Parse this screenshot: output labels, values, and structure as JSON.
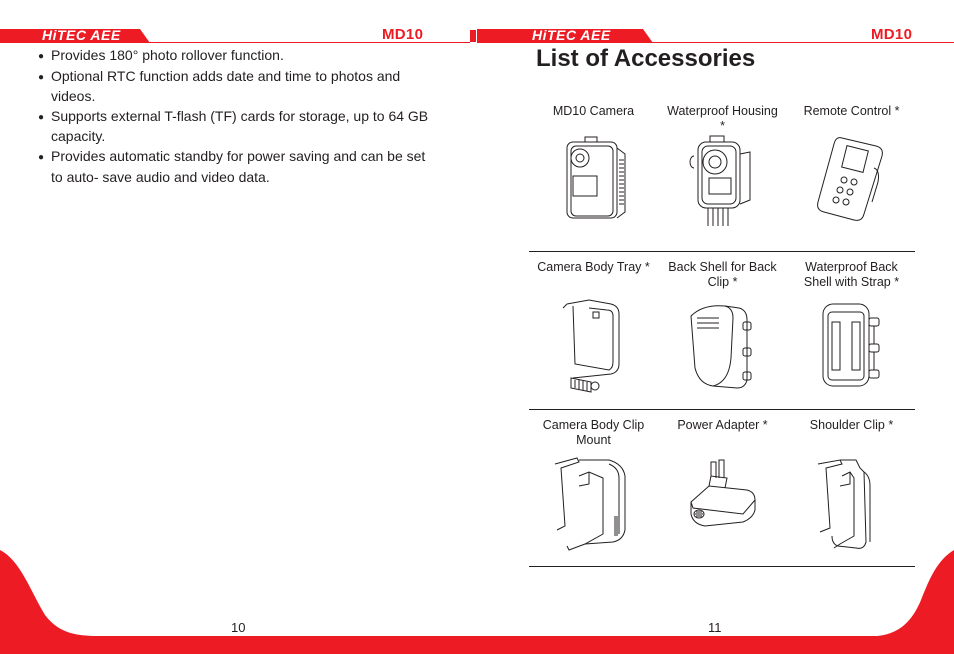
{
  "brand": {
    "logo_text": "HiTEC AEE",
    "model": "MD10",
    "accent_color": "#ed1c24"
  },
  "left_page": {
    "page_number": "10",
    "bullets": [
      "Provides 180° photo rollover function.",
      "Optional RTC function adds date and time to photos and videos.",
      "Supports external T-flash (TF) cards for storage, up to 64 GB capacity.",
      "Provides automatic standby for power saving and can be set to auto- save audio and video data."
    ]
  },
  "right_page": {
    "page_number": "11",
    "title": "List of Accessories",
    "accessories": [
      {
        "label": "MD10 Camera",
        "icon": "camera-icon"
      },
      {
        "label": "Waterproof Housing *",
        "icon": "waterproof-housing-icon"
      },
      {
        "label": "Remote Control *",
        "icon": "remote-control-icon"
      },
      {
        "label": "Camera Body Tray *",
        "icon": "body-tray-icon"
      },
      {
        "label": "Back Shell for Back Clip *",
        "icon": "back-shell-clip-icon"
      },
      {
        "label": "Waterproof Back Shell with Strap *",
        "icon": "back-shell-strap-icon"
      },
      {
        "label": "Camera Body Clip Mount",
        "icon": "clip-mount-icon"
      },
      {
        "label": "Power Adapter *",
        "icon": "power-adapter-icon"
      },
      {
        "label": "Shoulder Clip *",
        "icon": "shoulder-clip-icon"
      }
    ]
  }
}
